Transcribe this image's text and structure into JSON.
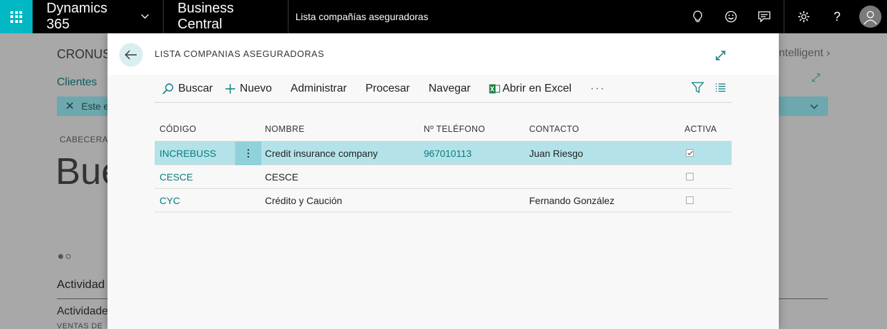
{
  "topbar": {
    "app_name": "Dynamics 365",
    "product": "Business Central",
    "page_crumb": "Lista compañías aseguradoras",
    "icons": [
      "waffle-icon",
      "chevron-down-icon",
      "lightbulb-icon",
      "smiley-icon",
      "chat-icon",
      "gear-icon",
      "help-icon",
      "avatar-icon"
    ],
    "help_glyph": "?"
  },
  "background": {
    "company": "CRONUS",
    "clientes": "Clientes",
    "filter_text": "Este e",
    "cabecera": "CABECERA",
    "big_text": "Bue",
    "activities_1": "Actividad",
    "activities_2": "Actividade",
    "ventas": "VENTAS DE",
    "intelligent": "ntelligent"
  },
  "dialog": {
    "title": "LISTA COMPANIAS ASEGURADORAS",
    "actions": {
      "buscar": "Buscar",
      "nuevo": "Nuevo",
      "administrar": "Administrar",
      "procesar": "Procesar",
      "navegar": "Navegar",
      "excel": "Abrir en Excel",
      "more": "···"
    },
    "columns": {
      "code": "CÓDIGO",
      "name": "NOMBRE",
      "phone": "Nº TELÉFONO",
      "contact": "CONTACTO",
      "active": "ACTIVA"
    },
    "rows": [
      {
        "code": "INCREBUSS",
        "name": "Credit insurance company",
        "phone": "967010113",
        "contact": "Juan Riesgo",
        "active": true,
        "selected": true
      },
      {
        "code": "CESCE",
        "name": "CESCE",
        "phone": "",
        "contact": "",
        "active": false,
        "selected": false
      },
      {
        "code": "CYC",
        "name": "Crédito y Caución",
        "phone": "",
        "contact": "Fernando González",
        "active": false,
        "selected": false
      }
    ]
  },
  "colors": {
    "accent": "#00b7c3",
    "link": "#0b7a80",
    "selected_row": "#b3e3e8",
    "topbar": "#000000"
  }
}
